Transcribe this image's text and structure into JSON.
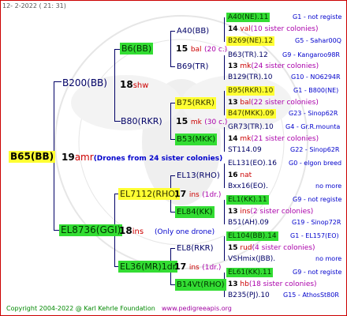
{
  "header": "12-  2-2022 ( 21: 31)",
  "footer": "Copyright 2004-2022 @ Karl Kehrle Foundation",
  "url": "www.pedigreeapis.org",
  "root": {
    "label": "B65(BB)",
    "n": "19",
    "race": "amr",
    "note": "(Drones from 24 sister colonies)"
  },
  "g1": [
    {
      "label": "B200(BB)",
      "n": "18",
      "race": "shw"
    },
    {
      "label": "EL8736(GGI)",
      "n": "18",
      "race": "ins",
      "note": "(Only one drone)"
    }
  ],
  "g2": [
    {
      "label": "B6(BB)",
      "n": "15",
      "race": "bal",
      "note": "(20 c.)"
    },
    {
      "label": "B80(RKR)",
      "n": "15",
      "race": "mk",
      "note": "(30 c.)"
    },
    {
      "label": "EL7112(RHO)",
      "n": "17",
      "race": "ins",
      "note": "(1dr.)"
    },
    {
      "label": "EL36(MR)1dr",
      "n": "17",
      "race": "ins",
      "note": "(1dr.)"
    }
  ],
  "g3": [
    {
      "label": "A40(BB)"
    },
    {
      "label": "B69(TR)"
    },
    {
      "label": "B75(RKR)"
    },
    {
      "label": "B53(MKK)"
    },
    {
      "label": "EL13(RHO)"
    },
    {
      "label": "EL84(KK)"
    },
    {
      "label": "EL8(RKR)"
    },
    {
      "label": "B14Vt(RHO)"
    }
  ],
  "g4": [
    {
      "label": "A40(NE).11",
      "right": "G1 - not registe"
    },
    {
      "n": "14",
      "race": "val",
      "note": "(10 sister colonies)"
    },
    {
      "label": "B269(NE).12",
      "right": "G5 - Sahar00Q"
    },
    {
      "label": "B63(TR).12",
      "right": "G9 - Kangaroo98R"
    },
    {
      "n": "13",
      "race": "mk",
      "note": "(24 sister colonies)"
    },
    {
      "label": "B129(TR).10",
      "right": "G10 - NO6294R"
    },
    {
      "label": "B95(RKR).10",
      "right": "G1 - B800(NE)"
    },
    {
      "n": "13",
      "race": "bal",
      "note": "(22 sister colonies)"
    },
    {
      "label": "B47(MKK).09",
      "right": "G23 - Sinop62R"
    },
    {
      "label": "GR73(TR).10",
      "right": "G4 - Gr.R.mounta"
    },
    {
      "n": "14",
      "race": "mk",
      "note": "(21 sister colonies)"
    },
    {
      "label": "ST114.09",
      "right": "G22 - Sinop62R"
    },
    {
      "label": "EL131(EO).16",
      "right": "G0 - elgon breed"
    },
    {
      "n": "16",
      "race": "nat"
    },
    {
      "label": "Bxx16(EO).",
      "right": "no more"
    },
    {
      "label": "EL1(KK).11",
      "right": "G9 - not registe"
    },
    {
      "n": "13",
      "race": "ins",
      "note": "(2 sister colonies)"
    },
    {
      "label": "B51(AH).09",
      "right": "G19 - Sinop72R"
    },
    {
      "label": "EL104(BB).14",
      "right": "G1 - EL157(EO)"
    },
    {
      "n": "15",
      "race": "rud",
      "note": "(4 sister colonies)"
    },
    {
      "label": "VSHmix(JBB).",
      "right": "no more"
    },
    {
      "label": "EL61(KK).11",
      "right": "G9 - not registe"
    },
    {
      "n": "13",
      "race": "hb",
      "note": "(18 sister colonies)"
    },
    {
      "label": "B235(PJ).10",
      "right": "G15 - AthosSt80R"
    }
  ]
}
